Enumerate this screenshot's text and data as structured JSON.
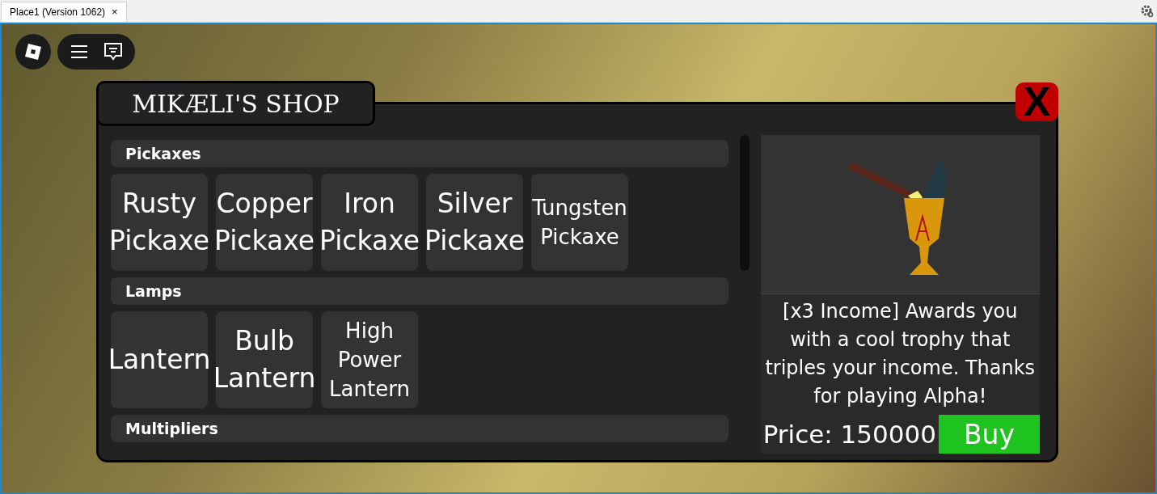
{
  "window": {
    "tab_title": "Place1 (Version 1062)",
    "tab_close": "×"
  },
  "shop": {
    "title": "MIKÆLI'S SHOP",
    "close": "X",
    "sections": [
      {
        "title": "Pickaxes",
        "items": [
          "Rusty Pickaxe",
          "Copper Pickaxe",
          "Iron Pickaxe",
          "Silver Pickaxe",
          "Tungsten Pickaxe"
        ]
      },
      {
        "title": "Lamps",
        "items": [
          "Lantern",
          "Bulb Lantern",
          "High Power Lantern"
        ]
      },
      {
        "title": "Multipliers"
      }
    ],
    "preview": {
      "description": "[x3 Income] Awards you with a cool trophy that triples your income. Thanks for playing Alpha!",
      "price": "Price: 150000",
      "buy": "Buy"
    }
  }
}
